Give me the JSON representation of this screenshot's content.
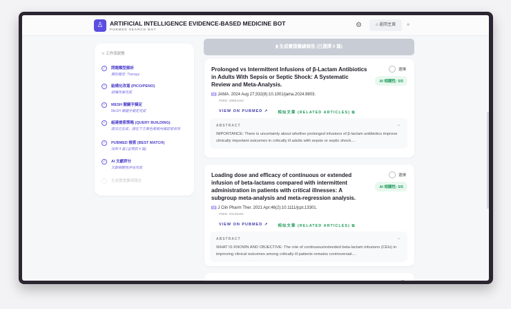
{
  "header": {
    "title": "ARTIFICIAL INTELLIGENCE EVIDENCE-BASED MEDICINE BOT",
    "subtitle": "PUBMED SEARCH BOT",
    "home": "⌂ 返回主頁"
  },
  "sidebar": {
    "heading": "工作流狀態",
    "steps": [
      {
        "label": "問題類型解析",
        "sub": "類別確定: Therapy"
      },
      {
        "label": "結構化改寫 (PICO/PENO)",
        "sub": "結構改寫完成"
      },
      {
        "label": "MESH 關鍵字擬定",
        "sub": "MeSH 關鍵字擬定完成"
      },
      {
        "label": "組建檢索策略 (QUERY BUILDING)",
        "sub": "語法已生成，請在下方黃色框框內確認或修改"
      },
      {
        "label": "PUBMED 檢索 (BEST MATCH)",
        "sub": "找到 4 篇 (呈現前 4 篇)"
      },
      {
        "label": "AI 文獻評分",
        "sub": "文獻相關性評估完成"
      },
      {
        "label": "生成實證彙總報告",
        "sub": ""
      }
    ]
  },
  "generate_button": "生成實證彙總報告 (已選擇 0 篇)",
  "common": {
    "select": "選擇",
    "view": "VIEW ON PUBMED ↗",
    "related": "相似文章 (RELATED ARTICLES) ⧉",
    "abstract": "ABSTRACT"
  },
  "articles": [
    {
      "title": "Prolonged vs Intermittent Infusions of β-Lactam Antibiotics in Adults With Sepsis or Septic Shock: A Systematic Review and Meta-Analysis.",
      "journal": "JAMA. 2024 Aug 27;332(8):10.1001/jama.2024.9803.",
      "pmid": "PMID: 38864162",
      "score": "AI 相關性: 5/5",
      "abstract": "IMPORTANCE: There is uncertainty about whether prolonged infusions of β-lactam antibiotics improve clinically important outcomes in critically ill adults with sepsis or septic shock...."
    },
    {
      "title": "Loading dose and efficacy of continuous or extended infusion of beta-lactams compared with intermittent administration in patients with critical illnesses: A subgroup meta-analysis and meta-regression analysis.",
      "journal": "J Clin Pharm Ther. 2021 Apr;46(2):10.1111/jcpt.13301.",
      "pmid": "PMID: 33135261",
      "score": "AI 相關性: 5/5",
      "abstract": "WHAT IS KNOWN AND OBJECTIVE: The role of continuous/extended beta-lactam infusions (CEIs) in improving clinical outcomes among critically ill patients remains controversial...."
    }
  ]
}
